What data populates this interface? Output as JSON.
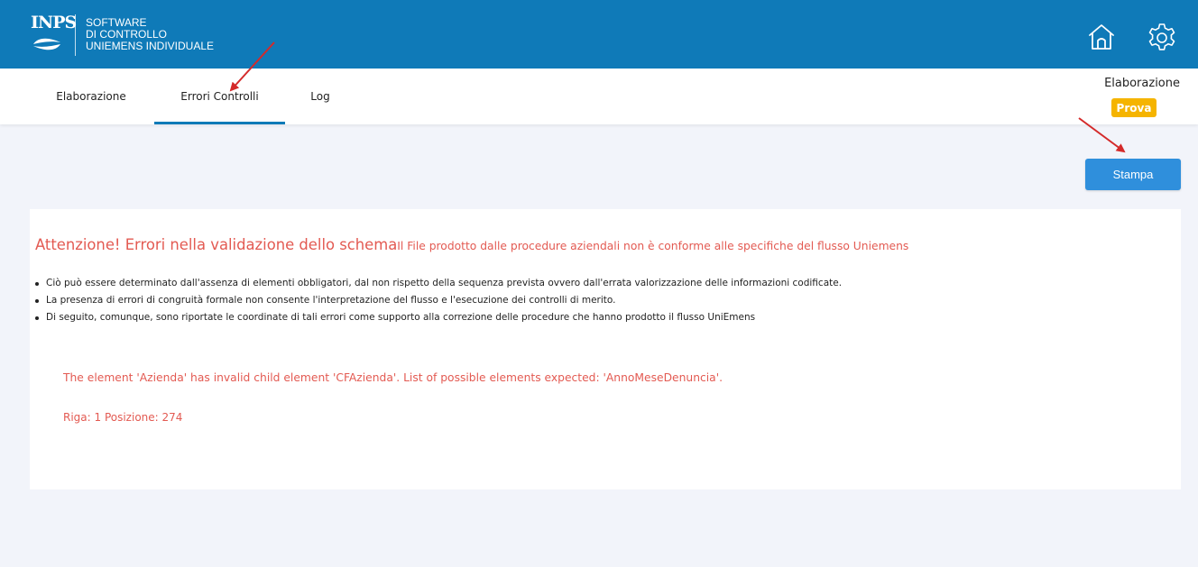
{
  "header": {
    "logo_text": "INPS",
    "app_title_lines": [
      "SOFTWARE",
      "DI CONTROLLO",
      "UNIEMENS INDIVIDUALE"
    ],
    "home_icon": "home-icon",
    "settings_icon": "gear-icon",
    "color": "#0f7ab8"
  },
  "tabs": [
    {
      "label": "Elaborazione",
      "active": false
    },
    {
      "label": "Errori Controlli",
      "active": true
    },
    {
      "label": "Log",
      "active": false
    }
  ],
  "status": {
    "label": "Elaborazione",
    "badge": "Prova",
    "badge_color": "#f5b400"
  },
  "actions": {
    "print_label": "Stampa",
    "print_color": "#2f8fdc"
  },
  "error_panel": {
    "title": "Attenzione! Errori nella validazione dello schema",
    "subtitle": "Il File prodotto dalle procedure aziendali non è conforme alle specifiche del flusso Uniemens",
    "bullets": [
      "Ciò può essere determinato dall'assenza di elementi obbligatori, dal non rispetto della sequenza prevista ovvero dall'errata valorizzazione delle informazioni codificate.",
      "La presenza di errori di congruità formale non consente l'interpretazione del flusso e l'esecuzione dei controlli di merito.",
      "Di seguito, comunque, sono riportate le coordinate di tali errori come supporto alla correzione delle procedure che hanno prodotto il flusso UniEmens"
    ],
    "error_message": "The element 'Azienda' has invalid child element 'CFAzienda'. List of possible elements expected: 'AnnoMeseDenuncia'.",
    "error_position": "Riga: 1 Posizione: 274",
    "error_color": "#e35a52"
  }
}
